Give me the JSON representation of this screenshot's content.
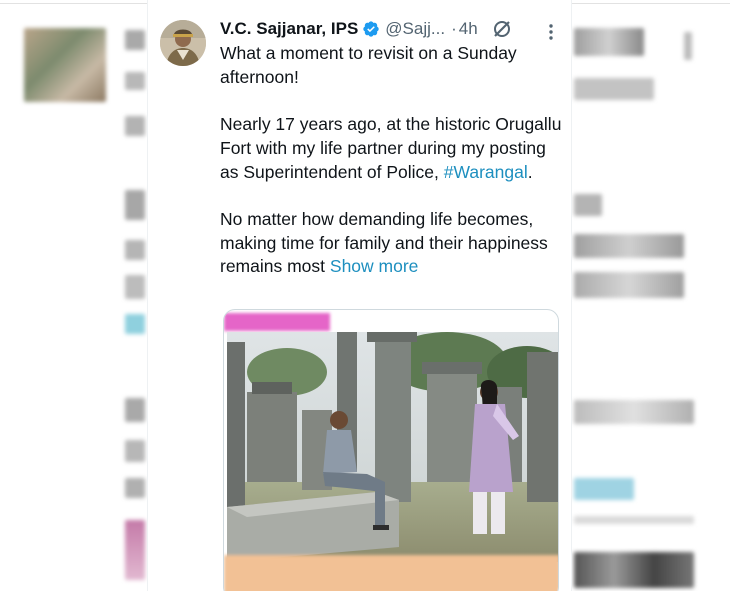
{
  "tweet": {
    "author_name": "V.C. Sajjanar, IPS",
    "handle": "@Sajj...",
    "separator": "·",
    "time": "4h",
    "text_line1": "What a moment to revisit on a Sunday afternoon!",
    "text_para2_before": "Nearly 17 years ago, at the historic Orugallu Fort with my life partner during my posting as Superintendent of Police, ",
    "hashtag": "#Warangal",
    "text_para2_after": ".",
    "text_para3": "No matter how demanding life becomes, making time for family and their happiness remains most ",
    "show_more": "Show more"
  },
  "icons": {
    "verified": "verified-badge-icon",
    "grok": "grok-icon",
    "more": "more-options-icon"
  },
  "colors": {
    "link": "#1d8fbf",
    "verified": "#1d9bf0",
    "secondary_text": "#536471",
    "media_pink_bar": "#e565c8",
    "media_caption_bar": "#f2c195"
  }
}
